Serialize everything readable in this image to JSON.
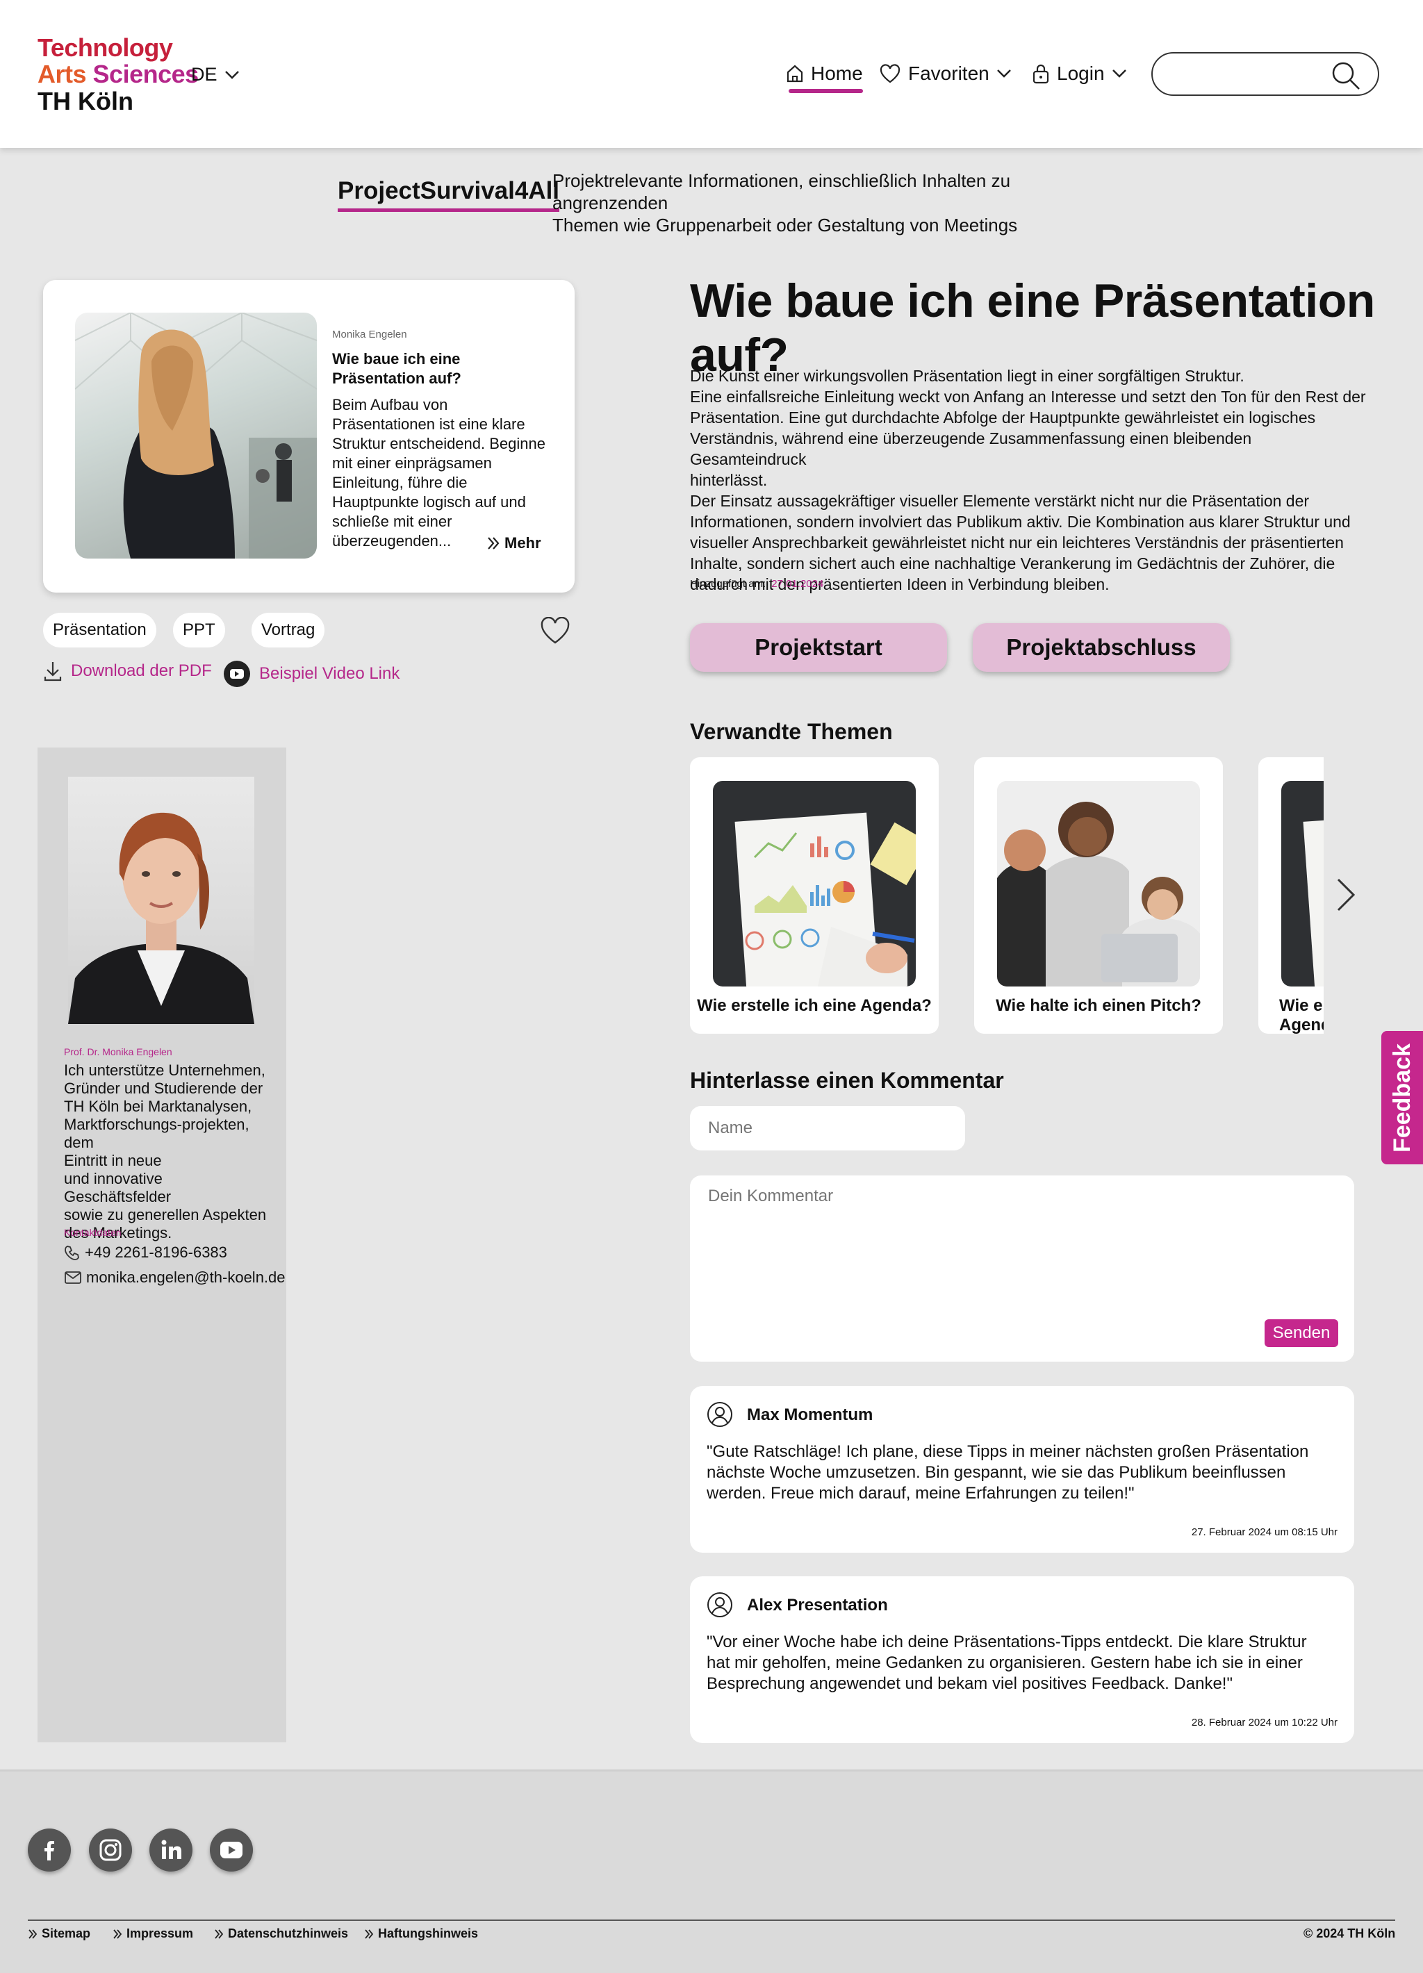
{
  "header": {
    "logo_line1": "Technology",
    "logo_line2_a": "Arts ",
    "logo_line2_b": "Sciences",
    "logo_line3": "TH Köln",
    "lang": "DE",
    "nav": {
      "home": "Home",
      "favorites": "Favoriten",
      "login": "Login"
    },
    "search_placeholder": ""
  },
  "intro": {
    "brand": "ProjectSurvival4All",
    "tagline_line1": "Projektrelevante Informationen, einschließlich Inhalten zu angrenzenden",
    "tagline_line2": "Themen wie Gruppenarbeit oder Gestaltung von Meetings"
  },
  "card": {
    "author": "Monika Engelen",
    "title": "Wie baue ich eine Präsentation auf?",
    "excerpt": "Beim Aufbau von Präsentationen ist eine klare Struktur entscheidend. Beginne mit einer einprägsamen Einleitung, führe die Hauptpunkte logisch auf und schließe mit einer überzeugenden...",
    "more": "Mehr"
  },
  "tags": [
    "Präsentation",
    "PPT",
    "Vortrag"
  ],
  "links": {
    "pdf": "Download der PDF",
    "video": "Beispiel Video Link"
  },
  "profile": {
    "name": "Prof. Dr. Monika Engelen",
    "bio_lines": [
      "Ich unterstütze Unternehmen,",
      "Gründer und Studierende der",
      "TH Köln bei Marktanalysen,",
      "Marktforschungs-projekten, dem",
      "Eintritt in neue",
      "und innovative Geschäftsfelder",
      "sowie zu generellen Aspekten",
      "des Marketings."
    ],
    "contact_label": "Kontaktdaten",
    "phone": "+49 2261-8196-6383",
    "email": "monika.engelen@th-koeln.de"
  },
  "article": {
    "title": "Wie baue ich eine Präsentation auf?",
    "paragraph_lines": [
      "Die Kunst einer wirkungsvollen Präsentation liegt in einer sorgfältigen Struktur.",
      "Eine einfallsreiche Einleitung weckt von Anfang an Interesse und setzt den Ton für den Rest der",
      "Präsentation. Eine gut durchdachte Abfolge der Hauptpunkte gewährleistet ein logisches",
      "Verständnis, während eine überzeugende Zusammenfassung einen bleibenden Gesamteindruck",
      "hinterlässt.",
      "Der Einsatz aussagekräftiger visueller Elemente verstärkt nicht nur die Präsentation der",
      "Informationen, sondern involviert das Publikum aktiv. Die Kombination aus klarer Struktur und",
      "visueller Ansprechbarkeit gewährleistet nicht nur ein leichteres Verständnis der präsentierten",
      "Inhalte, sondern sichert auch eine nachhaltige Verankerung im Gedächtnis der Zuhörer, die",
      "dadurch mit den präsentierten Ideen in Verbindung bleiben."
    ],
    "added_label": "Hinzugefügt am:",
    "added_date": "27.01.2024"
  },
  "phase_buttons": {
    "start": "Projektstart",
    "end": "Projektabschluss"
  },
  "related": {
    "heading": "Verwandte Themen",
    "items": [
      "Wie erstelle ich eine Agenda?",
      "Wie halte ich einen Pitch?",
      "Wie erstelle ich eine Agenda?"
    ]
  },
  "feedback": "Feedback",
  "comment_form": {
    "heading": "Hinterlasse einen Kommentar",
    "name_placeholder": "Name",
    "comment_placeholder": "Dein Kommentar",
    "send": "Senden"
  },
  "comments": [
    {
      "author": "Max Momentum",
      "text": "\"Gute Ratschläge! Ich plane, diese Tipps in meiner nächsten großen Präsentation nächste Woche umzusetzen. Bin gespannt, wie sie das Publikum beeinflussen werden. Freue mich darauf, meine Erfahrungen zu teilen!\"",
      "date": "27. Februar 2024 um 08:15 Uhr"
    },
    {
      "author": "Alex Presentation",
      "text": "\"Vor einer Woche habe ich deine Präsentations-Tipps entdeckt. Die klare Struktur hat mir geholfen, meine Gedanken zu organisieren. Gestern habe ich sie in einer Besprechung angewendet und bekam viel positives Feedback. Danke!\"",
      "date": "28. Februar 2024 um 10:22 Uhr"
    }
  ],
  "footer": {
    "links": [
      "Sitemap",
      "Impressum",
      "Datenschutzhinweis",
      "Haftungshinweis"
    ],
    "copyright": "© 2024 TH Köln"
  },
  "colors": {
    "accent": "#b5278a",
    "button_bg": "#e3bcd6",
    "feedback": "#c5278d"
  }
}
